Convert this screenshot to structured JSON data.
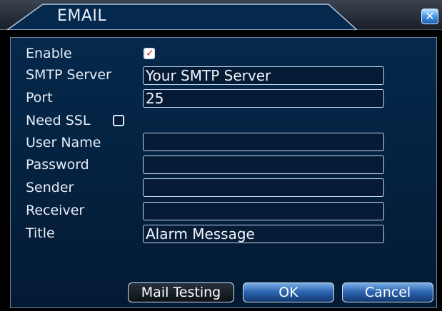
{
  "dialog": {
    "title": "EMAIL",
    "close_symbol": "✕"
  },
  "form": {
    "enable": {
      "label": "Enable",
      "checked": true
    },
    "smtp_server": {
      "label": "SMTP Server",
      "value": "Your SMTP Server"
    },
    "port": {
      "label": "Port",
      "value": "25"
    },
    "need_ssl": {
      "label": "Need SSL",
      "checked": false
    },
    "user_name": {
      "label": "User Name",
      "value": ""
    },
    "password": {
      "label": "Password",
      "value": ""
    },
    "sender": {
      "label": "Sender",
      "value": ""
    },
    "receiver": {
      "label": "Receiver",
      "value": ""
    },
    "title_field": {
      "label": "Title",
      "value": "Alarm Message"
    }
  },
  "buttons": {
    "mail_testing": "Mail Testing",
    "ok": "OK",
    "cancel": "Cancel"
  },
  "icons": {
    "close": "close-icon",
    "checkmark": "checkmark-icon"
  },
  "colors": {
    "panel_bg": "#05294c",
    "field_border": "#c7d8ee",
    "check_mark": "#e01a1a",
    "button_blue": "#2f67b4"
  }
}
